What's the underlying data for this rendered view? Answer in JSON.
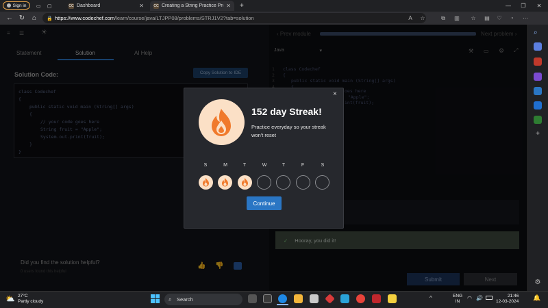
{
  "browser": {
    "signin_label": "Sign in",
    "tabs": [
      {
        "title": "Dashboard",
        "favicon": "CC"
      },
      {
        "title": "Creating a String Practice Proble",
        "favicon": "CC"
      }
    ],
    "url_host": "https://www.codechef.com",
    "url_path": "/learn/course/java/LTJPP08/problems/STRJ1V2?tab=solution"
  },
  "page": {
    "prev_module": "Prev module",
    "next_problem": "Next problem",
    "tabs": [
      "Statement",
      "Solution",
      "AI Help"
    ],
    "solution_heading": "Solution Code:",
    "copy_button": "Copy Solution to IDE",
    "code_lines": [
      "class Codechef",
      "{",
      "    public static void main (String[] args)",
      "    {",
      "        // your code goes here",
      "        String fruit = \"Apple\";",
      "        System.out.print(fruit);",
      "    }",
      "}"
    ],
    "language": "Java",
    "line_numbers": [
      "1",
      "2",
      "3",
      "4",
      "5"
    ],
    "editor_lines": [
      "class Codechef",
      "{",
      "    public static void main (String[] args)",
      "    {",
      "        // your code goes here"
    ],
    "editor_fragments": [
      "oes here",
      "\"Apple\";",
      "int(fruit);"
    ],
    "success_message": "Hooray, you did it!",
    "helpful_question": "Did you find the solution helpful?",
    "helpful_count": "0 users found this helpful",
    "submit_label": "Submit",
    "next_label": "Next"
  },
  "modal": {
    "title": "152 day Streak!",
    "text": "Practice everyday so your streak won't reset",
    "close": "×",
    "days": [
      {
        "label": "S",
        "done": true
      },
      {
        "label": "M",
        "done": true
      },
      {
        "label": "T",
        "done": true
      },
      {
        "label": "W",
        "done": false
      },
      {
        "label": "T",
        "done": false
      },
      {
        "label": "F",
        "done": false
      },
      {
        "label": "S",
        "done": false
      }
    ],
    "continue_label": "Continue"
  },
  "taskbar": {
    "weather_temp": "27°C",
    "weather_desc": "Partly cloudy",
    "search_label": "Search",
    "lang_line1": "ENG",
    "lang_line2": "IN",
    "time": "21:46",
    "date": "12-03-2024"
  },
  "colors": {
    "accent_blue": "#2a76c4",
    "flame_light": "#fbe0c6",
    "flame_orange": "#f07a2c",
    "success_green": "#2e7d32"
  }
}
